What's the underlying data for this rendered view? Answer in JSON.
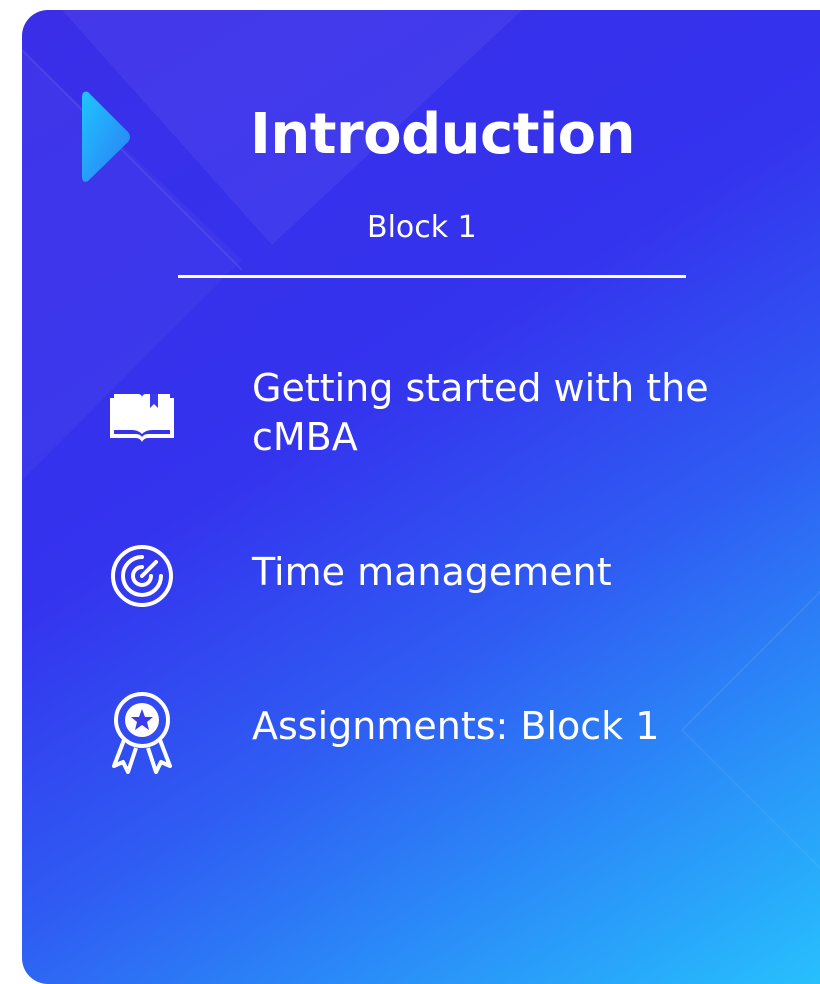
{
  "header": {
    "title": "Introduction",
    "subtitle": "Block 1"
  },
  "items": [
    {
      "icon": "open-book-icon",
      "label": "Getting started with the cMBA"
    },
    {
      "icon": "radar-icon",
      "label": "Time management"
    },
    {
      "icon": "award-ribbon-icon",
      "label": "Assignments: Block 1"
    }
  ],
  "colors": {
    "gradient_start": "#3a2ee8",
    "gradient_end": "#27c2fd",
    "marker_start": "#1fb8ff",
    "marker_end": "#2a7cf5",
    "text": "#ffffff"
  }
}
